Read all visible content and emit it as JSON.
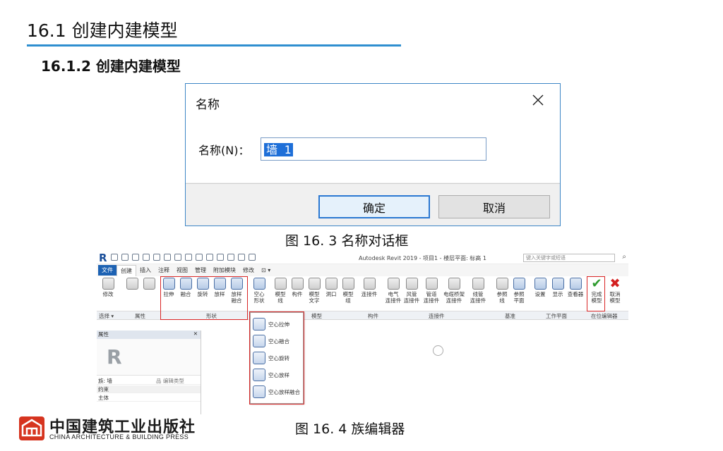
{
  "heading": {
    "main": "16.1 创建内建模型",
    "sub": "16.1.2   创建内建模型"
  },
  "name_dialog": {
    "title": "名称",
    "field_label": "名称(N)：",
    "field_value": "墙 1",
    "ok_label": "确定",
    "cancel_label": "取消"
  },
  "captions": {
    "fig1": "图 16. 3 名称对话框",
    "fig2": "图 16. 4 族编辑器"
  },
  "revit": {
    "logo": "R",
    "app_title": "Autodesk Revit 2019 -   项目1 - 楼层平面: 标高 1",
    "search_placeholder": "键入关键字或短语",
    "tabs": [
      "文件",
      "创建",
      "插入",
      "注释",
      "视图",
      "管理",
      "附加模块",
      "修改",
      "⊡ ▾"
    ],
    "ribbon": {
      "modify": "修改",
      "extrusion": "拉伸",
      "blend": "融合",
      "revolve": "旋转",
      "sweep": "放样",
      "swept_blend": "放样\n融合",
      "void_forms": "空心\n形状",
      "model_line": "模型\n线",
      "component": "构件",
      "model_text": "模型\n文字",
      "opening": "洞口",
      "model_group": "模型\n组",
      "connector": "连接件",
      "duct": "风管\n连接件",
      "pipe": "管道\n连接件",
      "electrical": "电气\n连接件",
      "cable_tray": "电缆桥架\n连接件",
      "conduit": "线管\n连接件",
      "ref_line": "参照\n线",
      "ref_plane": "参照\n平面",
      "set": "设置",
      "show": "显示",
      "viewer": "查看器",
      "finish_model": "完成\n模型",
      "cancel_model": "取消\n模型"
    },
    "panels": [
      "选择 ▾",
      "属性",
      "形状",
      "模型",
      "构件",
      "连接件",
      "基准",
      "工作平面",
      "在位编辑器"
    ],
    "void_menu": [
      "空心拉伸",
      "空心融合",
      "空心旋转",
      "空心放样",
      "空心放样融合"
    ],
    "properties": {
      "header": "属性",
      "close": "✕",
      "type_selector": "族: 墙",
      "edit_type": "品 编辑类型",
      "group": "约束",
      "row1": "主体"
    }
  },
  "publisher": {
    "name_cn": "中国建筑工业出版社",
    "name_en": "CHINA ARCHITECTURE & BUILDING PRESS"
  },
  "colors": {
    "accent_rule": "#2f8fd0",
    "highlight_box": "#d92626",
    "selection": "#1e6fd8"
  }
}
